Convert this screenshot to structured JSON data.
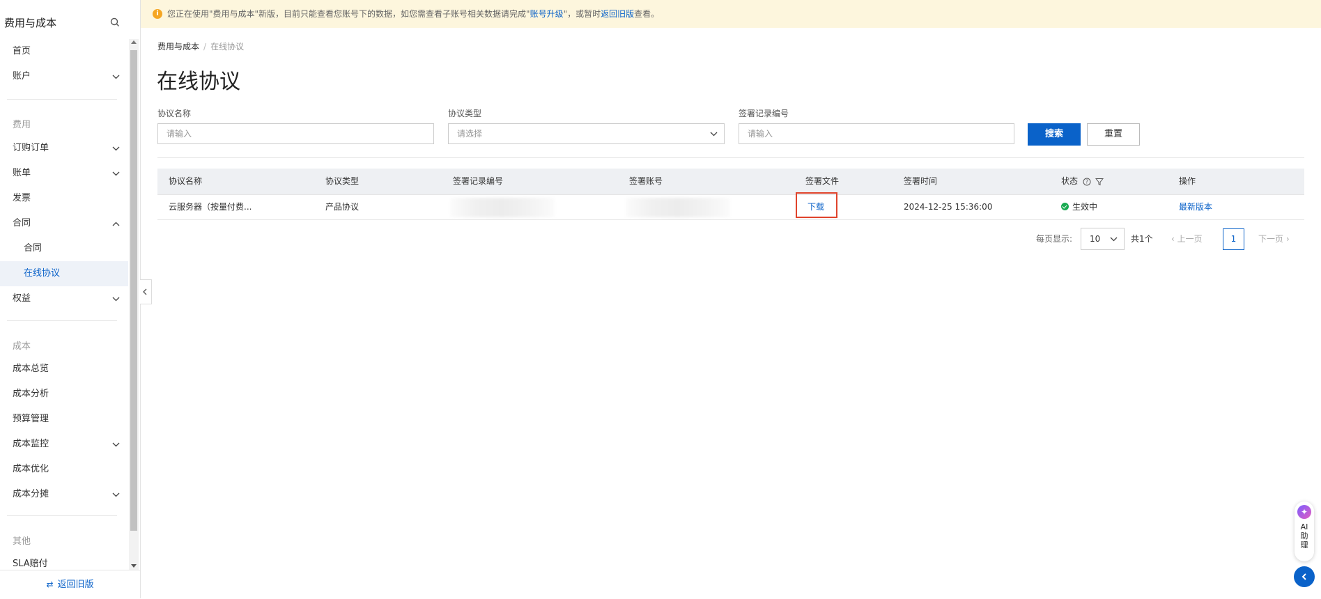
{
  "sidebar": {
    "title": "费用与成本",
    "footer_label": "返回旧版",
    "items": [
      {
        "label": "首页"
      },
      {
        "label": "账户"
      },
      {
        "label": "费用"
      },
      {
        "label": "订购订单"
      },
      {
        "label": "账单"
      },
      {
        "label": "发票"
      },
      {
        "label": "合同"
      },
      {
        "label": "合同"
      },
      {
        "label": "在线协议"
      },
      {
        "label": "权益"
      },
      {
        "label": "成本"
      },
      {
        "label": "成本总览"
      },
      {
        "label": "成本分析"
      },
      {
        "label": "预算管理"
      },
      {
        "label": "成本监控"
      },
      {
        "label": "成本优化"
      },
      {
        "label": "成本分摊"
      },
      {
        "label": "其他"
      },
      {
        "label": "SLA赔付"
      }
    ]
  },
  "notice": {
    "prefix": "您正在使用\"费用与成本\"新版，目前只能查看您账号下的数据，如您需查看子账号相关数据请完成\"",
    "upgrade_link": "账号升级",
    "middle": "\"，或暂时",
    "old_link": "返回旧版",
    "suffix": "查看。"
  },
  "breadcrumb": {
    "root": "费用与成本",
    "sep": "/",
    "current": "在线协议"
  },
  "page_title": "在线协议",
  "filters": {
    "name_label": "协议名称",
    "name_placeholder": "请输入",
    "type_label": "协议类型",
    "type_placeholder": "请选择",
    "record_label": "签署记录编号",
    "record_placeholder": "请输入",
    "search_button": "搜索",
    "reset_button": "重置"
  },
  "table": {
    "headers": [
      "协议名称",
      "协议类型",
      "签署记录编号",
      "签署账号",
      "签署文件",
      "签署时间",
      "状态",
      "操作"
    ],
    "rows": [
      {
        "name": "云服务器（按量付费...",
        "type": "产品协议",
        "file": "下载",
        "time": "2024-12-25 15:36:00",
        "status": "生效中",
        "action": "最新版本"
      }
    ]
  },
  "pagination": {
    "page_size_label": "每页显示:",
    "page_size": "10",
    "total": "共1个",
    "prev": "上一页",
    "current_page": "1",
    "next": "下一页"
  },
  "ai_assistant": {
    "label": "AI\n助\n理"
  },
  "colors": {
    "primary": "#0a62c9",
    "notice_bg": "#fdf6dd",
    "success": "#1bab52",
    "highlight": "#e0442c"
  }
}
